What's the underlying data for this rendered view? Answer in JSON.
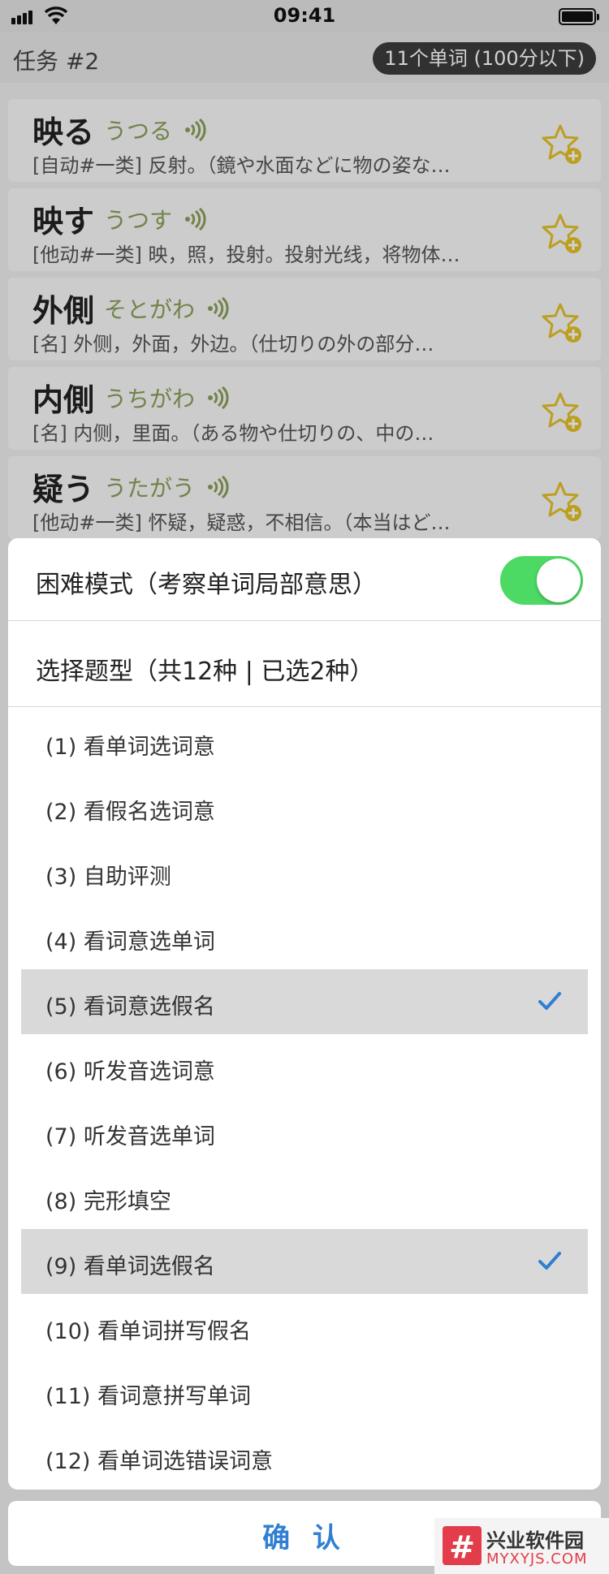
{
  "status_bar": {
    "time": "09:41"
  },
  "nav": {
    "title": "任务 #2",
    "badge": "11个单词 (100分以下)"
  },
  "words": [
    {
      "word": "映る",
      "kana": "うつる",
      "meaning": "[自动#一类] 反射。（鏡や水面などに物の姿な…"
    },
    {
      "word": "映す",
      "kana": "うつす",
      "meaning": "[他动#一类] 映，照，投射。投射光线，将物体…"
    },
    {
      "word": "外側",
      "kana": "そとがわ",
      "meaning": "[名] 外侧，外面，外边。（仕切りの外の部分…"
    },
    {
      "word": "内側",
      "kana": "うちがわ",
      "meaning": "[名] 内侧，里面。（ある物や仕切りの、中の…"
    },
    {
      "word": "疑う",
      "kana": "うたがう",
      "meaning": "[他动#一类] 怀疑，疑惑，不相信。（本当はど…"
    }
  ],
  "sheet": {
    "hard_mode_label": "困难模式（考察单词局部意思）",
    "hard_mode_on": true,
    "types_header": "选择题型（共12种 | 已选2种）",
    "options": [
      {
        "label": "(1) 看单词选词意",
        "selected": false
      },
      {
        "label": "(2) 看假名选词意",
        "selected": false
      },
      {
        "label": "(3) 自助评测",
        "selected": false
      },
      {
        "label": "(4) 看词意选单词",
        "selected": false
      },
      {
        "label": "(5) 看词意选假名",
        "selected": true
      },
      {
        "label": "(6) 听发音选词意",
        "selected": false
      },
      {
        "label": "(7) 听发音选单词",
        "selected": false
      },
      {
        "label": "(8) 完形填空",
        "selected": false
      },
      {
        "label": "(9) 看单词选假名",
        "selected": true
      },
      {
        "label": "(10) 看单词拼写假名",
        "selected": false
      },
      {
        "label": "(11) 看词意拼写单词",
        "selected": false
      },
      {
        "label": "(12) 看单词选错误词意",
        "selected": false
      }
    ]
  },
  "confirm_label": "确 认",
  "watermark": {
    "name": "兴业软件园",
    "domain": "MYXYJS.COM",
    "logo": "#"
  },
  "colors": {
    "toggle_on": "#4cd964",
    "accent": "#2f7fd3",
    "kana": "#8aa05a",
    "star": "#e6c229"
  }
}
